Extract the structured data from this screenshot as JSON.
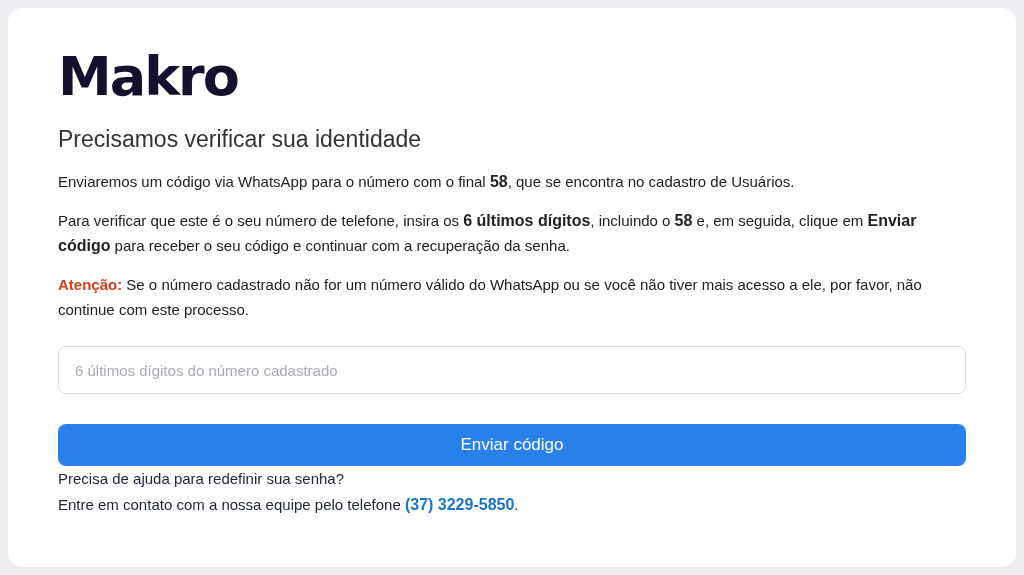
{
  "logo": {
    "text": "Makro"
  },
  "heading": "Precisamos verificar sua identidade",
  "paragraphs": [
    "Enviaremos um código via WhatsApp para o número com o final **58**, que se encontra no cadastro de Usuários.",
    "Para verificar que este é o seu número de telefone, insira os **6 últimos dígitos**, incluindo o **58** e, em seguida, clique em **Enviar código** para receber o seu código e continuar com a recuperação da senha."
  ],
  "warning": {
    "label": "Atenção:",
    "text": "Se o número cadastrado não for um número válido do WhatsApp ou se você não tiver mais acesso a ele, por favor, não continue com este processo."
  },
  "input": {
    "placeholder": "6 últimos dígitos do número cadastrado"
  },
  "button": {
    "label": "Enviar código"
  },
  "help": {
    "question": "Precisa de ajuda para redefinir sua senha?",
    "contact": "Entre em contato com a nossa equipe pelo telefone",
    "phone": "(37) 3229-5850",
    "end": "."
  }
}
